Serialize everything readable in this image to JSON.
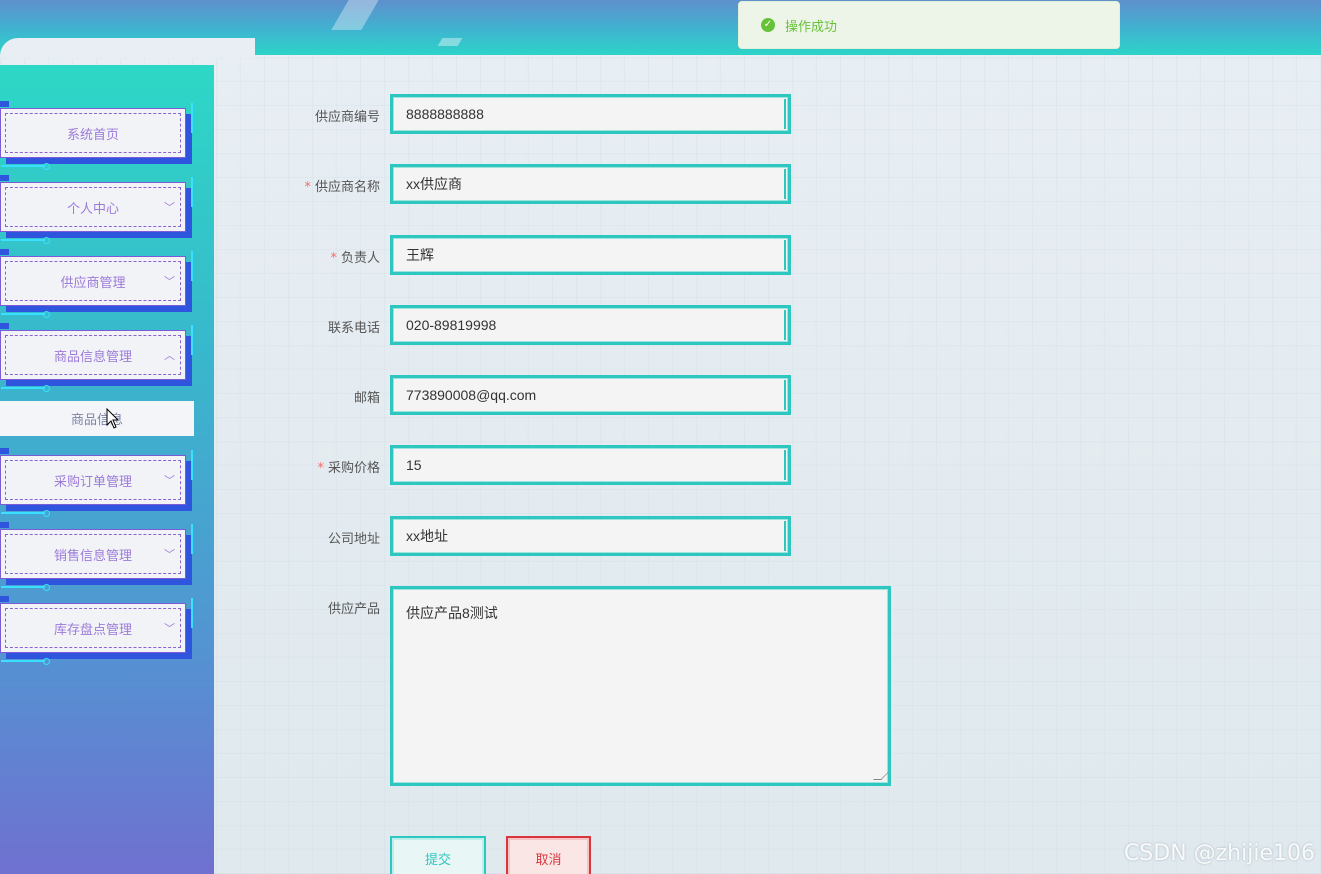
{
  "toast": {
    "message": "操作成功",
    "icon": "check-circle-icon",
    "color": "#67c23a"
  },
  "sidebar": {
    "items": [
      {
        "label": "系统首页",
        "expandable": false
      },
      {
        "label": "个人中心",
        "expandable": true,
        "chevron": "chevron-down-icon"
      },
      {
        "label": "供应商管理",
        "expandable": true,
        "chevron": "chevron-down-icon"
      },
      {
        "label": "商品信息管理",
        "expandable": true,
        "chevron": "chevron-up-icon",
        "expanded": true
      },
      {
        "label": "采购订单管理",
        "expandable": true,
        "chevron": "chevron-down-icon"
      },
      {
        "label": "销售信息管理",
        "expandable": true,
        "chevron": "chevron-down-icon"
      },
      {
        "label": "库存盘点管理",
        "expandable": true,
        "chevron": "chevron-down-icon"
      }
    ],
    "submenu": {
      "label": "商品信息"
    }
  },
  "form": {
    "fields": [
      {
        "label": "供应商编号",
        "required": false,
        "value": "8888888888"
      },
      {
        "label": "供应商名称",
        "required": true,
        "value": "xx供应商"
      },
      {
        "label": "负责人",
        "required": true,
        "value": "王辉"
      },
      {
        "label": "联系电话",
        "required": false,
        "value": "020-89819998"
      },
      {
        "label": "邮箱",
        "required": false,
        "value": "773890008@qq.com"
      },
      {
        "label": "采购价格",
        "required": true,
        "value": "15"
      },
      {
        "label": "公司地址",
        "required": false,
        "value": "xx地址"
      }
    ],
    "textarea": {
      "label": "供应产品",
      "value": "供应产品8测试"
    },
    "submit_label": "提交",
    "cancel_label": "取消",
    "required_mark": "*"
  },
  "colors": {
    "accent": "#2ec7c0",
    "danger": "#d9363e",
    "menu_text": "#9c7bd8",
    "required": "#f56c6c"
  },
  "watermark": "CSDN @zhijie106"
}
